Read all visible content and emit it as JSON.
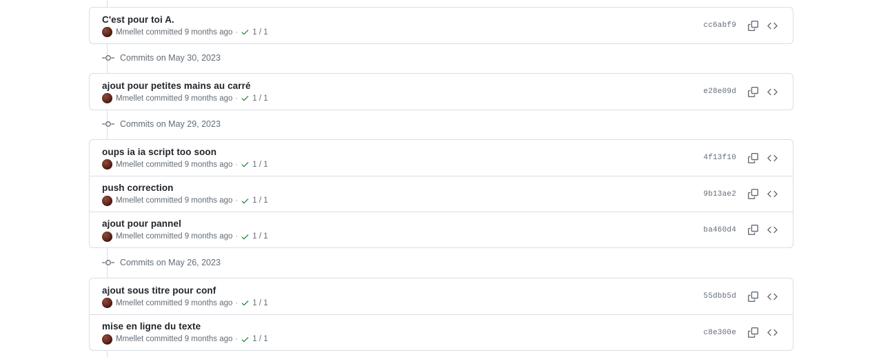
{
  "colors": {
    "background": "#ffffff",
    "border": "#d8dee4",
    "text_primary": "#1f2328",
    "text_muted": "#636c76",
    "check_green": "#1a7f37",
    "timeline": "#d8dee4"
  },
  "meta_labels": {
    "committed_text": "committed 9 months ago",
    "separator": "·",
    "checks": "1 / 1",
    "copy_icon": "copy-icon",
    "code_icon": "code-icon",
    "node_icon": "commit-node-icon",
    "check_icon": "check-success-icon",
    "avatar": "author-avatar"
  },
  "groups": [
    {
      "id": "group-0",
      "commits": [
        {
          "title": "C'est pour toi A.",
          "author": "Mmellet",
          "committed": "committed 9 months ago",
          "checks": "1 / 1",
          "sha": "cc6abf9"
        }
      ]
    },
    {
      "id": "group-1",
      "commits": [
        {
          "title": "ajout pour petites mains au carré",
          "author": "Mmellet",
          "committed": "committed 9 months ago",
          "checks": "1 / 1",
          "sha": "e28e09d"
        }
      ]
    },
    {
      "id": "group-2",
      "commits": [
        {
          "title": "oups ia ia script too soon",
          "author": "Mmellet",
          "committed": "committed 9 months ago",
          "checks": "1 / 1",
          "sha": "4f13f10"
        },
        {
          "title": "push correction",
          "author": "Mmellet",
          "committed": "committed 9 months ago",
          "checks": "1 / 1",
          "sha": "9b13ae2"
        },
        {
          "title": "ajout pour pannel",
          "author": "Mmellet",
          "committed": "committed 9 months ago",
          "checks": "1 / 1",
          "sha": "ba460d4"
        }
      ]
    },
    {
      "id": "group-3",
      "commits": [
        {
          "title": "ajout sous titre pour conf",
          "author": "Mmellet",
          "committed": "committed 9 months ago",
          "checks": "1 / 1",
          "sha": "55dbb5d"
        },
        {
          "title": "mise en ligne du texte",
          "author": "Mmellet",
          "committed": "committed 9 months ago",
          "checks": "1 / 1",
          "sha": "c8e300e"
        }
      ]
    }
  ],
  "date_separators": [
    {
      "label": "Commits on May 30, 2023"
    },
    {
      "label": "Commits on May 29, 2023"
    },
    {
      "label": "Commits on May 26, 2023"
    }
  ]
}
